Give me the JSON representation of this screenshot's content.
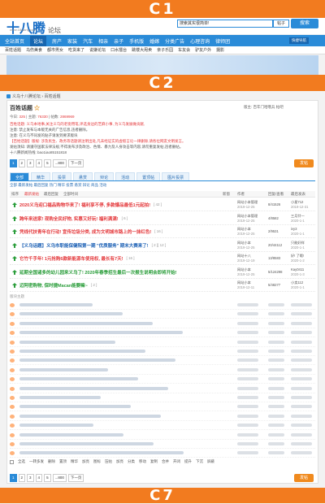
{
  "bands": {
    "top": "C1",
    "middle": "C2",
    "bottom": "C7"
  },
  "site": {
    "logo": "十八腾",
    "logo_suffix": "论坛",
    "domain": "www.18qiang.com"
  },
  "search": {
    "value": "搜索其实很简单!",
    "scope": "帖子",
    "button": "搜索"
  },
  "nav": {
    "items": [
      "全站首页",
      "论坛",
      "房产",
      "家装",
      "汽车",
      "相亲",
      "亲子",
      "手机版",
      "婚嫁",
      "分类广告",
      "心理咨询",
      "律师团"
    ],
    "active_index": 1,
    "right": "快捷导航"
  },
  "subnav": {
    "items": [
      "百姓话题",
      "乌伤美食",
      "都市男女",
      "吃货来了",
      "说嫌论坛",
      "口水擂台",
      "跳楼大甩卖",
      "亲子乐园",
      "车友会",
      "驴友户外",
      "摄影"
    ]
  },
  "breadcrumb": [
    "义乌十八腾论坛",
    "百姓话题"
  ],
  "forum": {
    "title": "百姓话题",
    "right_links": "版主: 百年门哈哦兵 帖吧",
    "stats_today_label": "今日:",
    "stats_today": "325",
    "stats_topics_label": "主题:",
    "stats_topics": "76330",
    "stats_posts_label": "帖数:",
    "stats_posts": "2869969",
    "desc_lines": [
      {
        "text": "百姓话题: 义乌本地事,关注义乌的老街用笔,评选身边的芝麻小事, 为义乌发展做贡献,",
        "red": true
      },
      {
        "text": "注意: 禁止发布与本版无关的广告信息,违者删除。",
        "red": false
      },
      {
        "text": "注意: 在义乌不同发的贴子请发到要求版块",
        "red": false
      },
      {
        "text": "【百姓话题】版规: 涉及民生、政务等话题请注明出处,凡未经证实的虚假言论一律删除,请各位网友文明发言。",
        "red": true
      },
      {
        "text": "发帖须知: 请遵守国家法律法规,不得发布涉及政治、色情、暴力及人身攻击等内容,请勿重复发帖,违者删帖。",
        "red": false
      },
      {
        "text": "十八腾新闻热线: bao1iao85151818",
        "red": false
      }
    ]
  },
  "pager": {
    "pages": [
      "1",
      "2",
      "3",
      "4",
      "5",
      "...800",
      "下一页"
    ],
    "current": "1",
    "post_button": "发帖"
  },
  "categories": {
    "items": [
      "全部",
      "精华",
      "投票",
      "悬赏",
      "辩论",
      "活动",
      "置顶帖",
      "图片投票"
    ],
    "active_index": 0
  },
  "filters": "全部  最新发帖  最后回复  热门  精华  投票  悬赏  辩论  商品  活动",
  "table_head": {
    "sort": "排序",
    "latest": "最新发帖",
    "reply_sort": "最后回复",
    "all_time": "全部时间",
    "new": "新窗",
    "author": "作者",
    "replies": "回复/查看",
    "last": "最后发表"
  },
  "threads": [
    {
      "title": "2020义乌迎口福品购物华来了! 福利享不停, 多款爆品最低1元起拍!",
      "color": "#e4393c",
      "count": "[ 42 ]",
      "author": "网站小本管理",
      "date": "2019-12-25",
      "replies": "8/41526",
      "last_user": "小星712",
      "last_date": "2019-12-31"
    },
    {
      "title": "跨年来送家! 现购全民好物, 实惠又好玩! 福利满满!",
      "color": "#e4393c",
      "count": "[ 6 ]",
      "author": "网站小本管理",
      "date": "2019-12-25",
      "replies": "4/8582",
      "last_user": "三月廿一",
      "last_date": "2020-1-1"
    },
    {
      "title": "凭线代扶青年在行动! 宣传垃圾分类, 成为文明城市路上的一抹红色!",
      "color": "#e4393c",
      "count": "[ 16 ]",
      "author": "网站小本",
      "date": "2019-12-25",
      "replies": "2/9531",
      "last_user": "ivy3",
      "last_date": "2020-1-1"
    },
    {
      "title": "【义乌话题】义乌市职能保健院第一期 \"优质服务\" 期末大赛来了!",
      "color": "#1a5fb4",
      "count": "[ 2 ][ 12 ]",
      "author": "网站小本",
      "date": "2019-12-25",
      "replies": "20/44112",
      "last_user": "只能好样",
      "last_date": "2020-1-1"
    },
    {
      "title": "它竹千手年! 1元抢购6款新能源车使用权, 最长有7天!",
      "color": "#e4393c",
      "count": "[ 16 ]",
      "author": "网站十八",
      "date": "2019-12-19",
      "replies": "13/8583",
      "last_user": "好! 了哦!",
      "last_date": "2020-1-2"
    },
    {
      "title": "延期全国诸多的幼儿园来义乌了! 2020年春季招生最后一次报生说明会即将开始!",
      "color": "#2a9d3a",
      "count": "",
      "author": "网站小本",
      "date": "2019-12-25",
      "replies": "5/124298",
      "last_user": "Kay0411",
      "last_date": "2020-1-3"
    },
    {
      "title": "迈阿密购物, 保时捷Macan能要嘛~",
      "color": "#2a9d3a",
      "count": "[ 2 ]",
      "author": "网站小本",
      "date": "2019-12-11",
      "replies": "5/48277",
      "last_user": "小卖112",
      "last_date": "2020-1-1"
    }
  ],
  "sub_head": "版块主题",
  "batch": {
    "items": [
      "全选",
      "一转多发",
      "删除",
      "置顶",
      "精华",
      "加亮",
      "图标",
      "压帖",
      "加亮",
      "分类",
      "移动",
      "复制",
      "合并",
      "开闭",
      "提升",
      "下沉",
      "屏蔽"
    ]
  },
  "footer_pager": {
    "pages": [
      "1",
      "2",
      "3",
      "4",
      "5",
      "...800",
      "下一页"
    ],
    "current": "1"
  }
}
